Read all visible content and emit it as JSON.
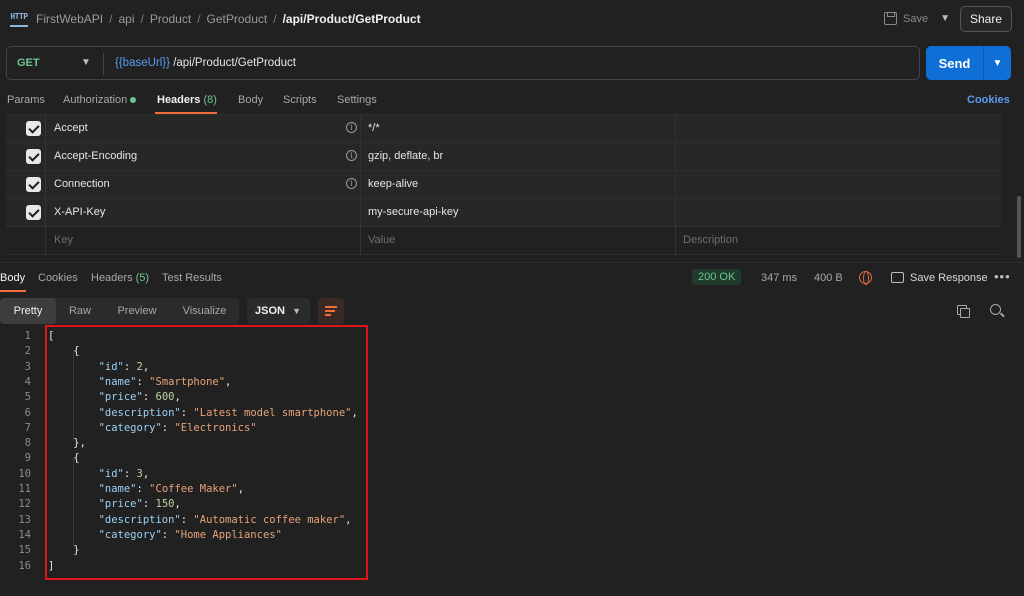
{
  "header": {
    "app_icon_text": "HTTP",
    "breadcrumbs": [
      "FirstWebAPI",
      "api",
      "Product",
      "GetProduct"
    ],
    "current": "/api/Product/GetProduct",
    "save_label": "Save",
    "share_label": "Share"
  },
  "request": {
    "method": "GET",
    "url_variable": "{{baseUrl}}",
    "url_path": " /api/Product/GetProduct",
    "send_label": "Send"
  },
  "request_tabs": {
    "params": "Params",
    "authorization": "Authorization",
    "headers": "Headers",
    "headers_count": "(8)",
    "body": "Body",
    "scripts": "Scripts",
    "settings": "Settings",
    "cookies": "Cookies"
  },
  "headers_table": {
    "rows": [
      {
        "key": "Accept",
        "value": "*/*"
      },
      {
        "key": "Accept-Encoding",
        "value": "gzip, deflate, br"
      },
      {
        "key": "Connection",
        "value": "keep-alive"
      },
      {
        "key": "X-API-Key",
        "value": "my-secure-api-key"
      }
    ],
    "placeholders": {
      "key": "Key",
      "value": "Value",
      "description": "Description"
    }
  },
  "response_tabs": {
    "body": "Body",
    "cookies": "Cookies",
    "headers": "Headers",
    "headers_count": "(5)",
    "test_results": "Test Results"
  },
  "response_meta": {
    "status": "200 OK",
    "time": "347 ms",
    "size": "400 B",
    "save_response": "Save Response"
  },
  "format_tabs": {
    "pretty": "Pretty",
    "raw": "Raw",
    "preview": "Preview",
    "visualize": "Visualize",
    "language": "JSON"
  },
  "colors": {
    "accent": "#f26b3a",
    "send": "#0f6fd6",
    "status_ok": "#6cc793",
    "highlight": "#e0141c"
  },
  "code": {
    "line_numbers": [
      "1",
      "2",
      "3",
      "4",
      "5",
      "6",
      "7",
      "8",
      "9",
      "10",
      "11",
      "12",
      "13",
      "14",
      "15",
      "16"
    ],
    "items": [
      {
        "id": "2",
        "name": "\"Smartphone\"",
        "price": "600",
        "description": "\"Latest model smartphone\"",
        "category": "\"Electronics\""
      },
      {
        "id": "3",
        "name": "\"Coffee Maker\"",
        "price": "150",
        "description": "\"Automatic coffee maker\"",
        "category": "\"Home Appliances\""
      }
    ],
    "keys": {
      "id": "\"id\"",
      "name": "\"name\"",
      "price": "\"price\"",
      "description": "\"description\"",
      "category": "\"category\""
    }
  }
}
